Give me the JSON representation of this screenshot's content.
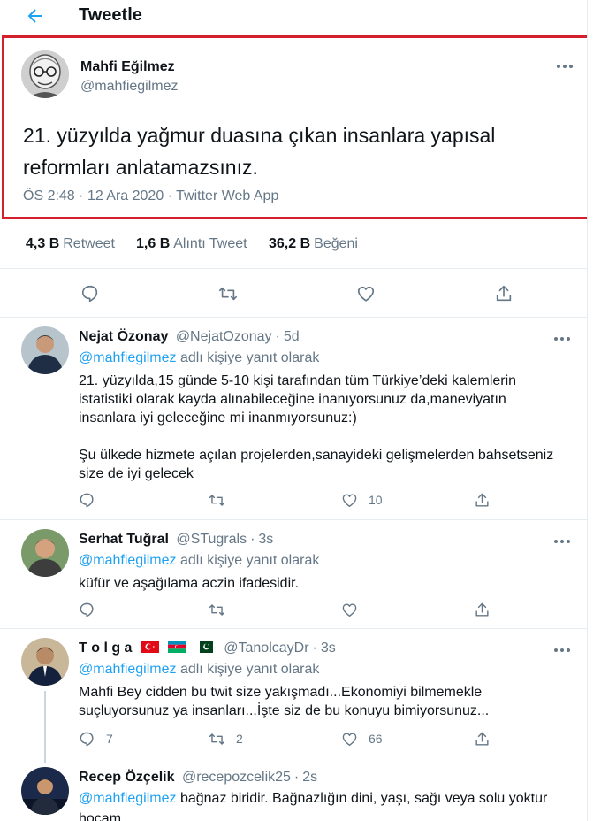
{
  "header": {
    "title": "Tweetle",
    "back_icon": "arrow-left-icon"
  },
  "colors": {
    "accent": "#1da1f2",
    "secondary_text": "#657786",
    "highlight_border": "#d4202c"
  },
  "main_tweet": {
    "author_name": "Mahfi Eğilmez",
    "author_handle": "@mahfiegilmez",
    "text_line1": "21. yüzyılda yağmur duasına çıkan insanlara yapısal",
    "text_line2": "reformları anlatamazsınız.",
    "meta": "ÖS 2:48 · 12 Ara 2020 · Twitter Web App"
  },
  "stats": {
    "retweets_count": "4,3 B",
    "retweets_label": "Retweet",
    "quotes_count": "1,6 B",
    "quotes_label": "Alıntı Tweet",
    "likes_count": "36,2 B",
    "likes_label": "Beğeni"
  },
  "replies": [
    {
      "name": "Nejat Özonay",
      "handle": "@NejatOzonay",
      "time": "5d",
      "replying_mention": "@mahfiegilmez",
      "replying_suffix": "adlı kişiye yanıt olarak",
      "body": [
        "21. yüzyılda,15 günde 5-10 kişi tarafından tüm Türkiye’deki kalemlerin",
        "istatistiki olarak kayda alınabileceğine inanıyorsunuz da,maneviyatın",
        "insanlara iyi geleceğine mi inanmıyorsunuz:)",
        "",
        "Şu ülkede hizmete açılan projelerden,sanayideki gelişmelerden bahsetseniz",
        "size de iyi gelecek"
      ],
      "reply_count": "",
      "retweet_count": "",
      "like_count": "10"
    },
    {
      "name": "Serhat Tuğral",
      "handle": "@STugrals",
      "time": "3s",
      "replying_mention": "@mahfiegilmez",
      "replying_suffix": "adlı kişiye yanıt olarak",
      "body": [
        "küfür ve aşağılama aczin ifadesidir."
      ],
      "reply_count": "",
      "retweet_count": "",
      "like_count": ""
    },
    {
      "name": "T o l g a",
      "handle": "@TanolcayDr",
      "time": "3s",
      "flags": [
        "turkey-flag-icon",
        "azerbaijan-flag-icon",
        "pakistan-flag-icon"
      ],
      "replying_mention": "@mahfiegilmez",
      "replying_suffix": "adlı kişiye yanıt olarak",
      "body": [
        "Mahfi Bey cidden bu twit size yakışmadı...Ekonomiyi bilmemekle",
        "suçluyorsunuz ya insanları...İşte siz de bu konuyu bimiyorsunuz..."
      ],
      "reply_count": "7",
      "retweet_count": "2",
      "like_count": "66"
    },
    {
      "name": "Recep Özçelik",
      "handle": "@recepozcelik25",
      "time": "2s",
      "replying_mention": "@mahfiegilmez",
      "replying_suffix": "bağnaz biridir. Bağnazlığın dini, yaşı, sağı veya solu yoktur",
      "body": [
        "hocam."
      ]
    }
  ]
}
